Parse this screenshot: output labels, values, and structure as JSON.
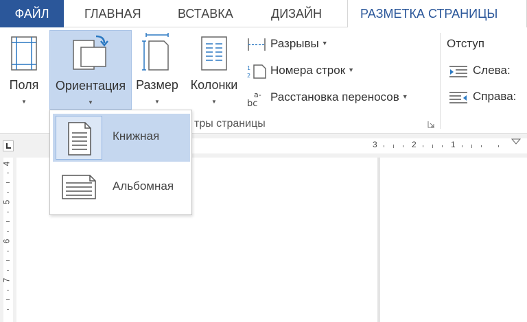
{
  "tabs": {
    "file": "ФАЙЛ",
    "home": "ГЛАВНАЯ",
    "insert": "ВСТАВКА",
    "design": "ДИЗАЙН",
    "layout": "РАЗМЕТКА СТРАНИЦЫ"
  },
  "ribbon": {
    "margins": "Поля",
    "orientation": "Ориентация",
    "size": "Размер",
    "columns": "Колонки",
    "breaks": "Разрывы",
    "line_numbers": "Номера строк",
    "hyphenation": "Расстановка переносов",
    "group_label": "тры страницы",
    "indent_title": "Отступ",
    "indent_left": "Слева:",
    "indent_right": "Справа:"
  },
  "ruler": {
    "h_numbers": [
      "3",
      "2",
      "1"
    ],
    "v_numbers": [
      "4",
      "5",
      "6",
      "7"
    ]
  },
  "orientation_menu": {
    "portrait": "Книжная",
    "landscape": "Альбомная",
    "selected": "portrait"
  },
  "colors": {
    "file_tab": "#2b579a",
    "accent": "#2b579a",
    "selected": "#c5d7ef"
  }
}
